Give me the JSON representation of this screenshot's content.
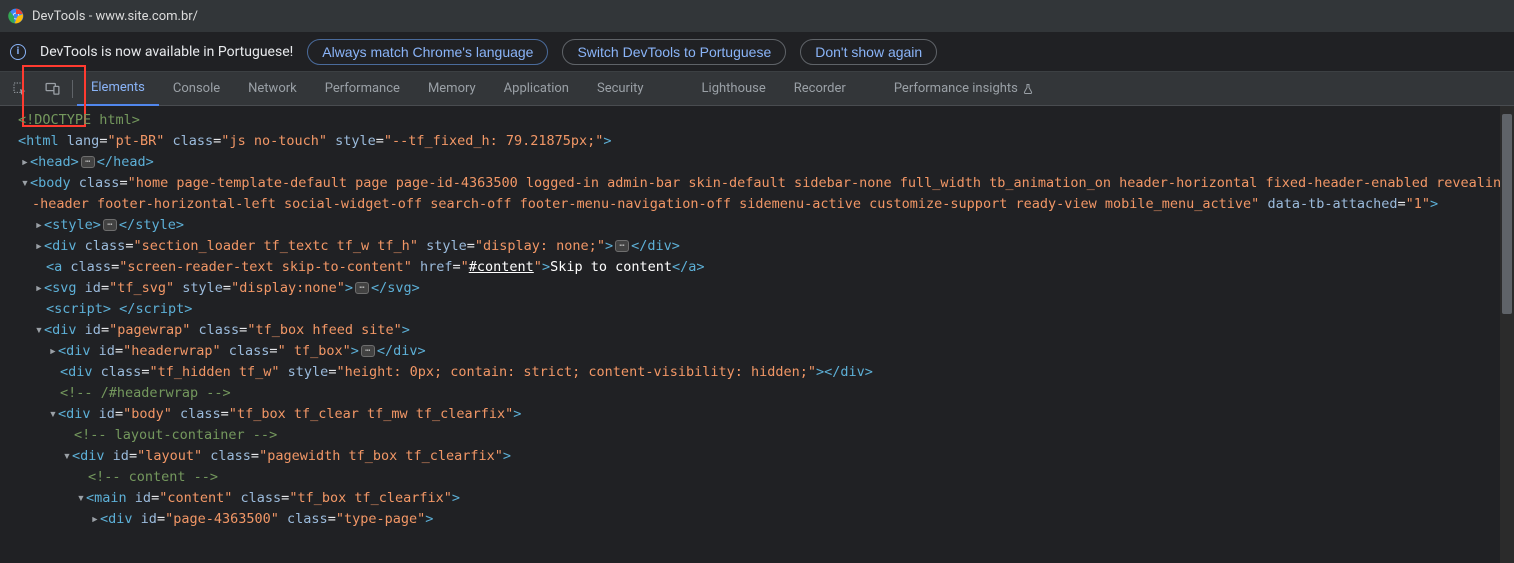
{
  "title_prefix": "DevTools - ",
  "title_url": "www.site.com.br/",
  "infobar": {
    "message": "DevTools is now available in Portuguese!",
    "buttons": [
      "Always match Chrome's language",
      "Switch DevTools to Portuguese",
      "Don't show again"
    ]
  },
  "tabs": [
    "Elements",
    "Console",
    "Network",
    "Performance",
    "Memory",
    "Application",
    "Security",
    "Lighthouse",
    "Recorder",
    "Performance insights"
  ],
  "active_tab": "Elements",
  "code": {
    "doctype": "<!DOCTYPE html>",
    "html_open": {
      "tag": "html",
      "lang": "pt-BR",
      "class": "js no-touch",
      "style": "--tf_fixed_h: 79.21875px;"
    },
    "head": {
      "tag": "head"
    },
    "body_open": {
      "tag": "body",
      "class": "home page-template-default page page-id-4363500 logged-in admin-bar skin-default sidebar-none full_width tb_animation_on header-horizontal fixed-header-enabled revealing-header footer-horizontal-left social-widget-off search-off footer-menu-navigation-off sidemenu-active customize-support ready-view mobile_menu_active",
      "data_tb": "1"
    },
    "style": {
      "tag": "style"
    },
    "loader": {
      "tag": "div",
      "class": "section_loader tf_textc tf_w tf_h",
      "style": "display: none;"
    },
    "a_skip": {
      "tag": "a",
      "class": "screen-reader-text skip-to-content",
      "href": "#content",
      "text": "Skip to content"
    },
    "svg": {
      "tag": "svg",
      "id": "tf_svg",
      "style": "display:none"
    },
    "script": {
      "tag": "script"
    },
    "pagewrap": {
      "tag": "div",
      "id": "pagewrap",
      "class": "tf_box hfeed site"
    },
    "headerwrap": {
      "tag": "div",
      "id": "headerwrap",
      "class": " tf_box"
    },
    "hidden": {
      "tag": "div",
      "class": "tf_hidden tf_w",
      "style": "height: 0px; contain: strict; content-visibility: hidden;"
    },
    "cmt_headerwrap": "<!-- /#headerwrap -->",
    "body_div": {
      "tag": "div",
      "id": "body",
      "class": "tf_box tf_clear tf_mw tf_clearfix"
    },
    "cmt_layout": "<!-- layout-container -->",
    "layout": {
      "tag": "div",
      "id": "layout",
      "class": "pagewidth tf_box tf_clearfix"
    },
    "cmt_content": "<!-- content -->",
    "main": {
      "tag": "main",
      "id": "content",
      "class": "tf_box tf_clearfix"
    },
    "pagediv": {
      "tag": "div",
      "id": "page-4363500",
      "class": "type-page"
    }
  }
}
